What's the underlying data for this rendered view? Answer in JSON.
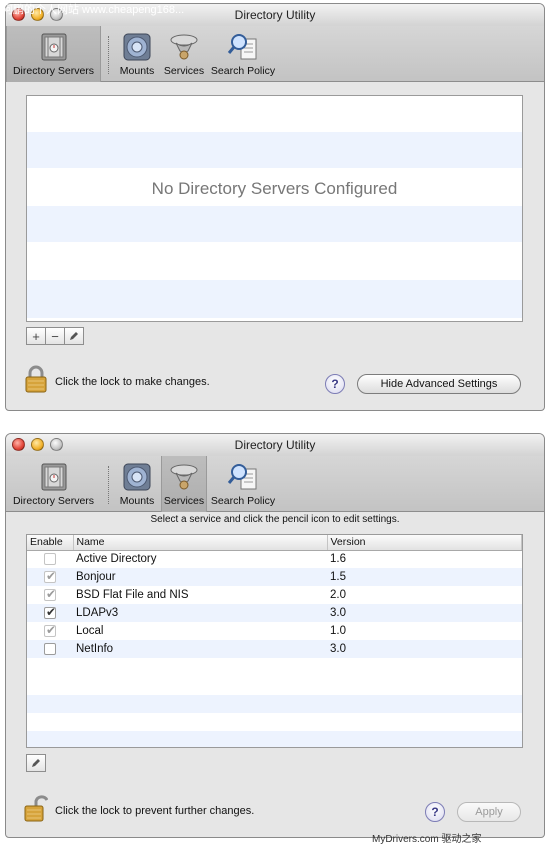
{
  "window_top": {
    "title": "Directory Utility",
    "toolbar": {
      "items": [
        "Directory Servers",
        "Mounts",
        "Services",
        "Search Policy"
      ],
      "selected": "Directory Servers"
    },
    "servers_panel": {
      "empty_message": "No Directory Servers Configured"
    },
    "buttons": {
      "add": "+",
      "remove": "−"
    },
    "lock_text": "Click the lock to make changes.",
    "help_label": "?",
    "advanced_button": "Hide Advanced Settings"
  },
  "window_bottom": {
    "title": "Directory Utility",
    "toolbar": {
      "items": [
        "Directory Servers",
        "Mounts",
        "Services",
        "Search Policy"
      ],
      "selected": "Services"
    },
    "hint": "Select a service and click the pencil icon to edit settings.",
    "table": {
      "columns": [
        "Enable",
        "Name",
        "Version"
      ],
      "rows": [
        {
          "name": "Active Directory",
          "version": "1.6",
          "checked": false,
          "enabled": false
        },
        {
          "name": "Bonjour",
          "version": "1.5",
          "checked": true,
          "enabled": false
        },
        {
          "name": "BSD Flat File and NIS",
          "version": "2.0",
          "checked": true,
          "enabled": false
        },
        {
          "name": "LDAPv3",
          "version": "3.0",
          "checked": true,
          "enabled": true
        },
        {
          "name": "Local",
          "version": "1.0",
          "checked": true,
          "enabled": false
        },
        {
          "name": "NetInfo",
          "version": "3.0",
          "checked": false,
          "enabled": true
        }
      ]
    },
    "lock_text": "Click the lock to prevent further changes.",
    "help_label": "?",
    "apply_button": "Apply"
  },
  "watermarks": {
    "top": "阿鹏的个人网站  www.cheapeng168...",
    "bottom": "MyDrivers.com 驱动之家"
  },
  "colors": {
    "stripe": "#edf3fe",
    "window_bg": "#e6e6e6"
  }
}
